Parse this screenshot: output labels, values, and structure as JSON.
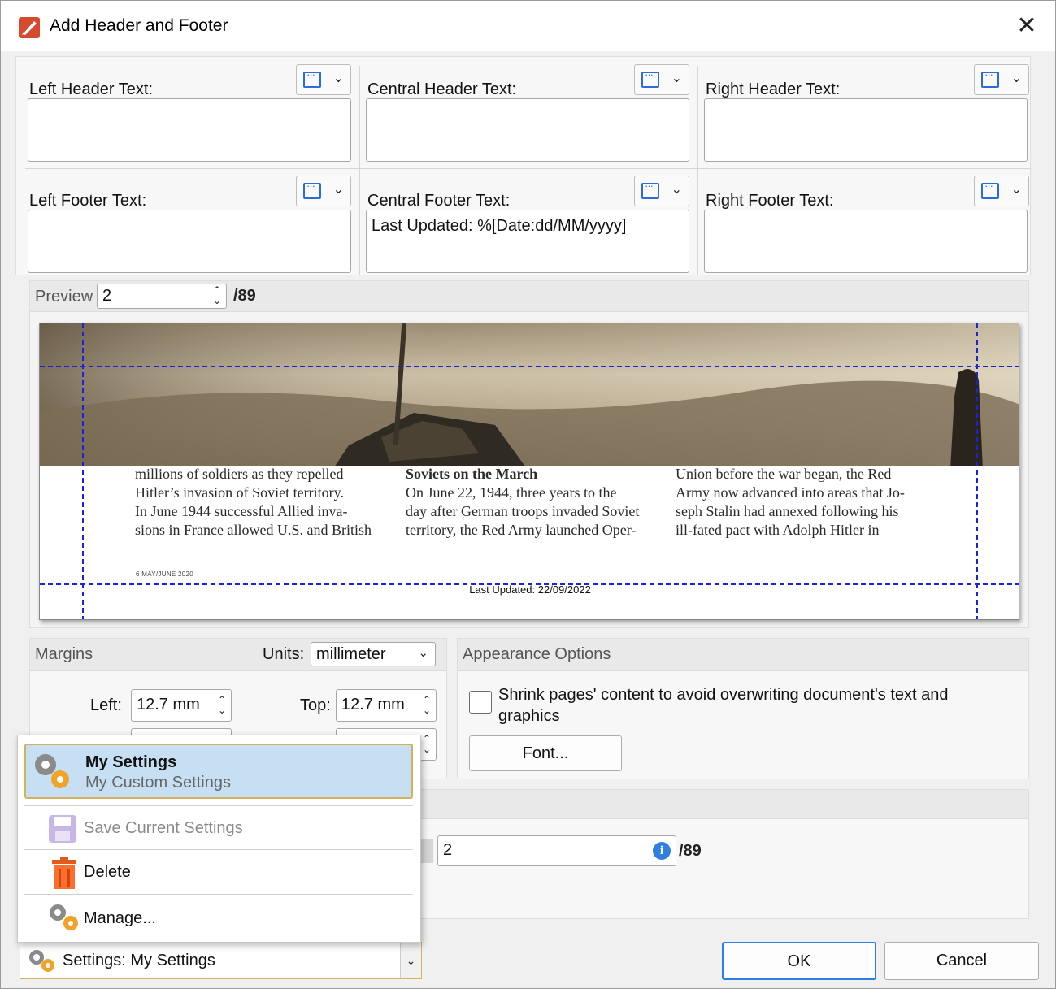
{
  "window": {
    "title": "Add Header and Footer",
    "close_glyph": "✕"
  },
  "header": {
    "left_label": "Left Header Text:",
    "central_label": "Central Header Text:",
    "right_label": "Right Header Text:",
    "left_value": "",
    "central_value": "",
    "right_value": ""
  },
  "footer": {
    "left_label": "Left Footer Text:",
    "central_label": "Central Footer Text:",
    "right_label": "Right Footer Text:",
    "left_value": "",
    "central_value": "Last Updated: %[Date:dd/MM/yyyy]",
    "right_value": ""
  },
  "macro_icon": "insert-macro-icon",
  "preview": {
    "label": "Preview",
    "page": "2",
    "total": "/89",
    "article_col1": [
      "millions of soldiers as they repelled",
      "Hitler’s invasion of Soviet territory.",
      "   In June 1944 successful Allied inva-",
      "sions in France allowed U.S. and British"
    ],
    "article_col2": [
      "Soviets on the March",
      "On June 22, 1944, three years to the",
      "day after German troops invaded Soviet",
      "territory, the Red Army launched Oper-"
    ],
    "article_col3": [
      "Union before the war began, the Red",
      "Army now advanced into areas that Jo-",
      "seph Stalin had annexed following his",
      "ill-fated pact with Adolph Hitler in"
    ],
    "page_number": "6  MAY/JUNE 2020",
    "footer_rendered": "Last Updated: 22/09/2022"
  },
  "margins": {
    "title": "Margins",
    "units_label": "Units:",
    "units_value": "millimeter",
    "left_label": "Left:",
    "left_value": "12.7 mm",
    "top_label": "Top:",
    "top_value": "12.7 mm"
  },
  "appearance": {
    "title": "Appearance Options",
    "shrink_label_line1": "Shrink pages' content to avoid overwriting document's text and",
    "shrink_label_line2": "graphics",
    "font_button": "Font..."
  },
  "page_range": {
    "to_value": "2",
    "total": "/89"
  },
  "settings_menu": {
    "selected_title": "My Settings",
    "selected_sub": "My Custom Settings",
    "save": "Save Current Settings",
    "delete": "Delete",
    "manage": "Manage..."
  },
  "settings_bar": {
    "label": "Settings:  My Settings"
  },
  "buttons": {
    "ok": "OK",
    "cancel": "Cancel"
  },
  "colors": {
    "guide": "#1a24d6",
    "accent_border": "#d3b35a",
    "selection": "#c6dff2",
    "info": "#2f7fe0"
  }
}
